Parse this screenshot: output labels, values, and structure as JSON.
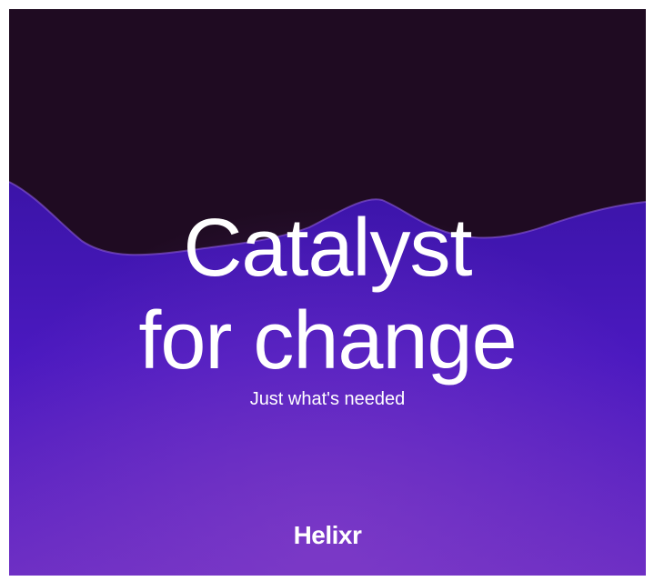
{
  "poster": {
    "headline_line1": "Catalyst",
    "headline_line2": "for change",
    "subtitle": "Just what's needed",
    "brand": "Helixr"
  },
  "colors": {
    "top_background": "#1d0a1f",
    "mid_purple": "#4818b8",
    "bottom_purple": "#6a2cc2",
    "text": "#ffffff"
  }
}
